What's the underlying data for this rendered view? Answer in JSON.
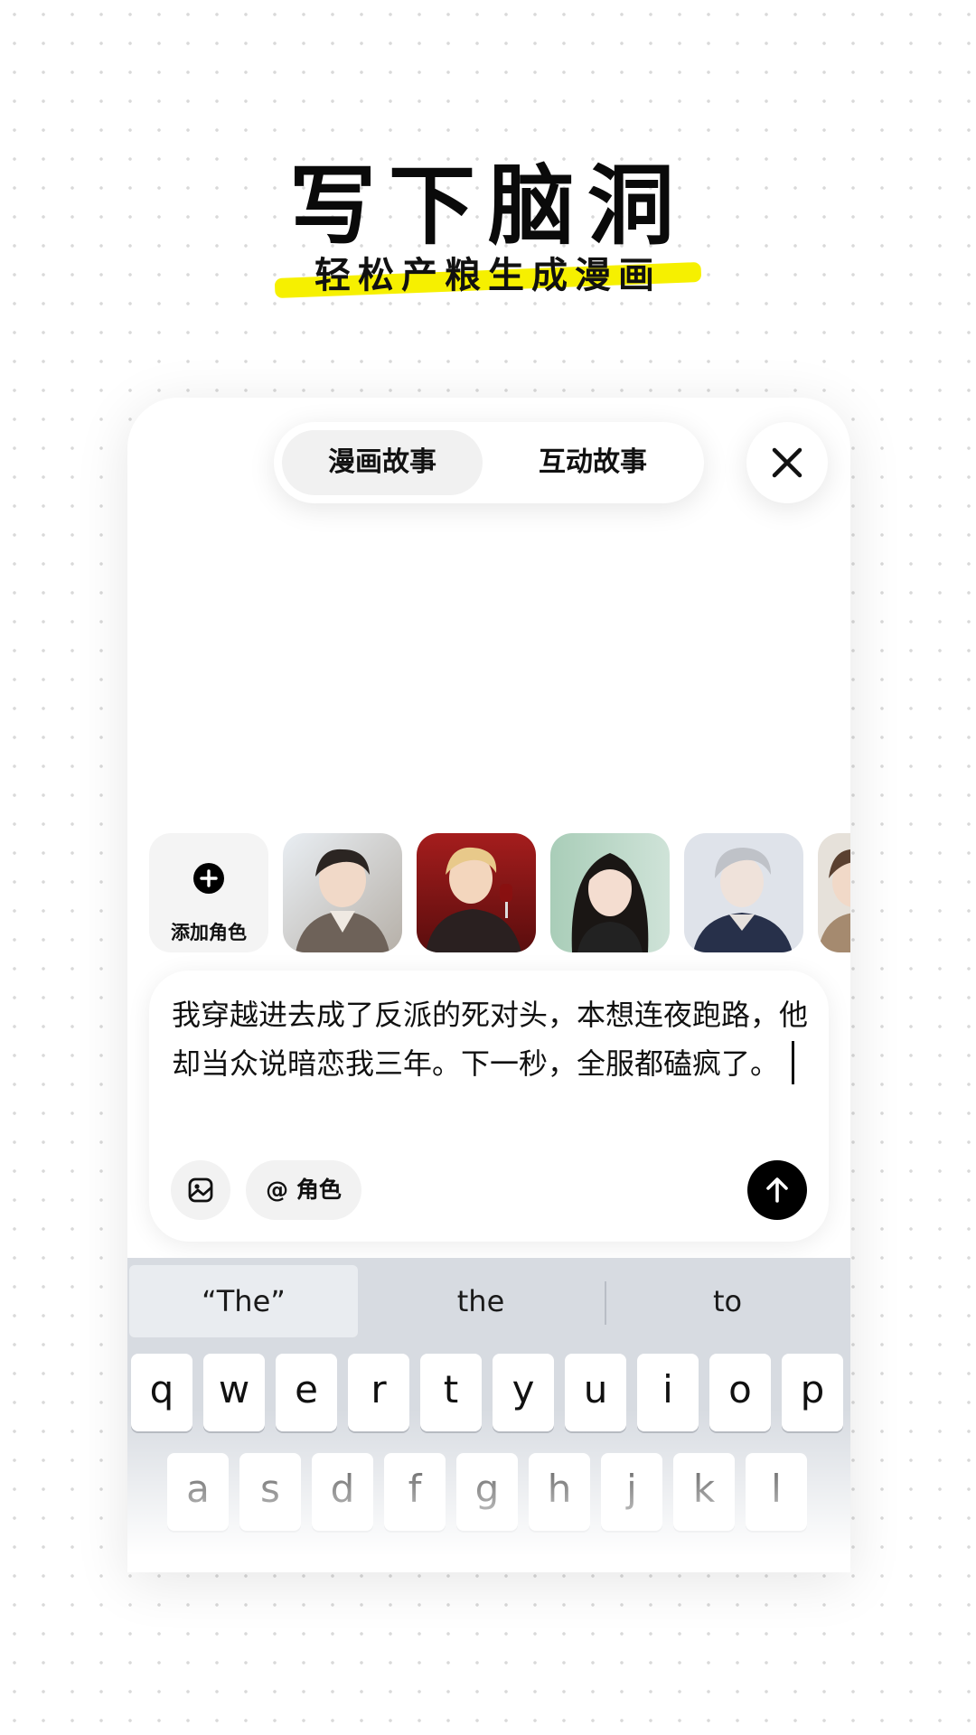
{
  "header": {
    "title": "写下脑洞",
    "subtitle": "轻松产粮生成漫画"
  },
  "tabs": [
    {
      "label": "漫画故事",
      "active": true
    },
    {
      "label": "互动故事",
      "active": false
    }
  ],
  "close_icon": "close-icon",
  "characters": {
    "add_label": "添加角色",
    "avatars": [
      "character-1",
      "character-2",
      "character-3",
      "character-4",
      "character-5",
      "character-6"
    ]
  },
  "input": {
    "text": "我穿越进去成了反派的死对头，本想连夜跑路，他却当众说暗恋我三年。下一秒，全服都磕疯了。",
    "role_label": "@ 角色"
  },
  "keyboard": {
    "suggestions": [
      "“The”",
      "the",
      "to"
    ],
    "row1": [
      "q",
      "w",
      "e",
      "r",
      "t",
      "y",
      "u",
      "i",
      "o",
      "p"
    ],
    "row2": [
      "a",
      "s",
      "d",
      "f",
      "g",
      "h",
      "j",
      "k",
      "l"
    ]
  },
  "colors": {
    "highlight": "#f6f000",
    "send_button": "#000000",
    "keyboard_bg": "#d7dbe1"
  }
}
